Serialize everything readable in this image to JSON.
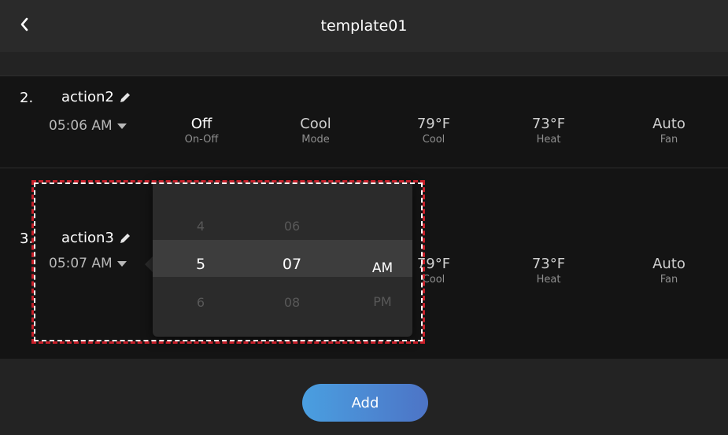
{
  "header": {
    "title": "template01",
    "back_icon": "chevron-left-icon"
  },
  "actions": [
    {
      "index": "2.",
      "name": "action2",
      "time": "05:06 AM",
      "settings": [
        {
          "value": "Off",
          "label": "On-Off"
        },
        {
          "value": "Cool",
          "label": "Mode"
        },
        {
          "value": "79°F",
          "label": "Cool"
        },
        {
          "value": "73°F",
          "label": "Heat"
        },
        {
          "value": "Auto",
          "label": "Fan"
        }
      ]
    },
    {
      "index": "3.",
      "name": "action3",
      "time": "05:07 AM",
      "settings": [
        {
          "value": "79°F",
          "label": "Cool"
        },
        {
          "value": "73°F",
          "label": "Heat"
        },
        {
          "value": "Auto",
          "label": "Fan"
        }
      ]
    }
  ],
  "time_picker": {
    "hours": [
      "4",
      "5",
      "6"
    ],
    "minutes": [
      "06",
      "07",
      "08"
    ],
    "periods": [
      "AM",
      "PM"
    ],
    "selected": {
      "hour": "5",
      "minute": "07",
      "period": "AM"
    }
  },
  "footer": {
    "add_label": "Add"
  },
  "colors": {
    "accent_start": "#4a9fe0",
    "accent_end": "#4d74c6",
    "highlight_box": "#c8202a"
  }
}
